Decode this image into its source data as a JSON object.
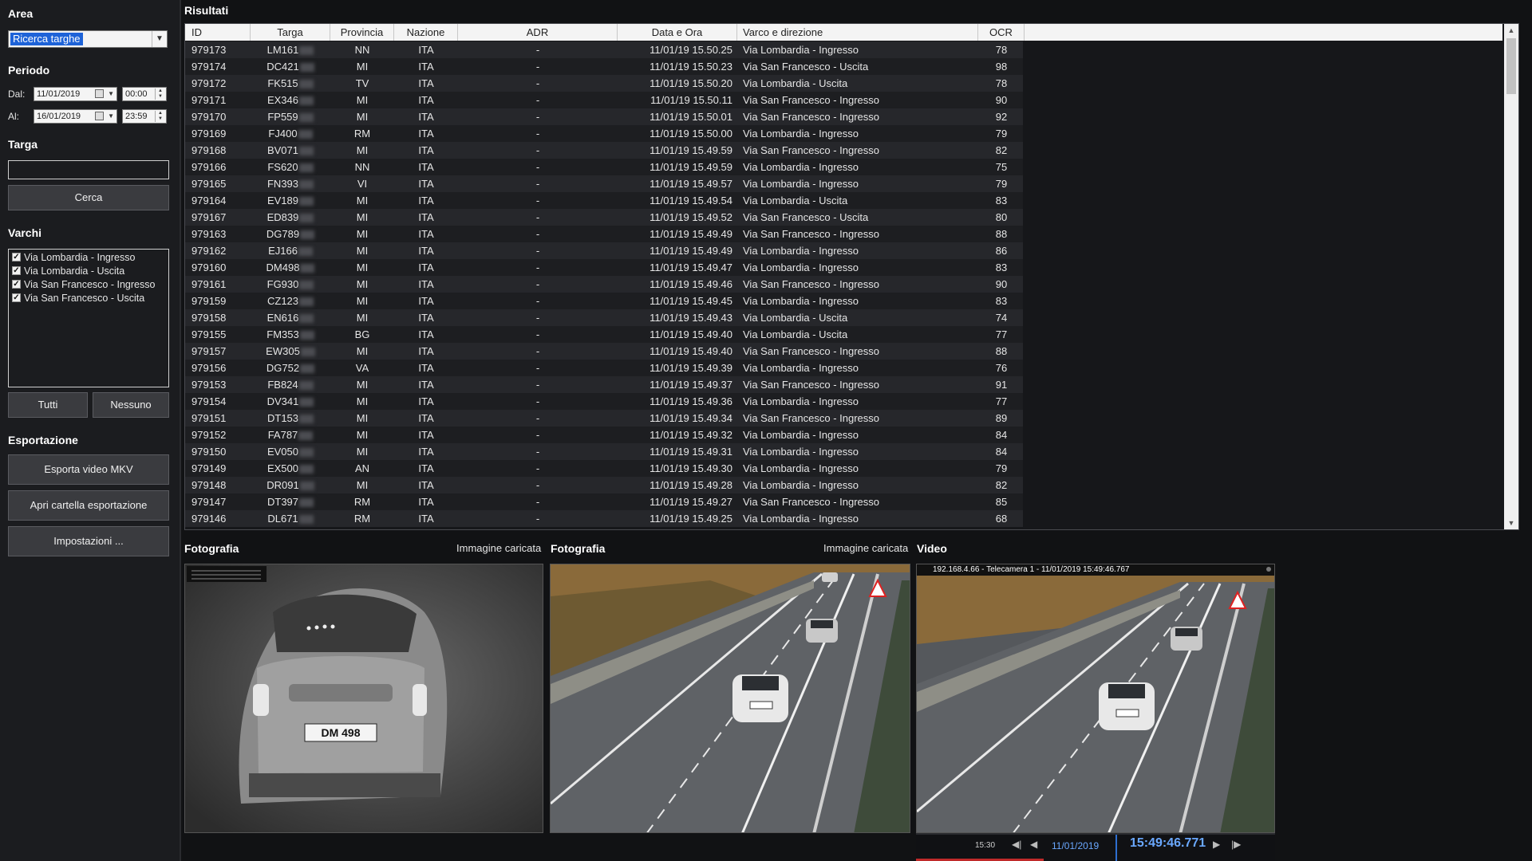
{
  "sidebar": {
    "area_title": "Area",
    "area_value": "Ricerca targhe",
    "period_title": "Periodo",
    "from_label": "Dal:",
    "from_date": "11/01/2019",
    "from_time": "00:00",
    "to_label": "Al:",
    "to_date": "16/01/2019",
    "to_time": "23:59",
    "plate_title": "Targa",
    "plate_value": "",
    "search_label": "Cerca",
    "gates_title": "Varchi",
    "gates": [
      {
        "label": "Via Lombardia - Ingresso",
        "checked": true
      },
      {
        "label": "Via Lombardia - Uscita",
        "checked": true
      },
      {
        "label": "Via San Francesco - Ingresso",
        "checked": true
      },
      {
        "label": "Via San Francesco - Uscita",
        "checked": true
      }
    ],
    "all_label": "Tutti",
    "none_label": "Nessuno",
    "export_title": "Esportazione",
    "export_mkv_label": "Esporta video MKV",
    "open_folder_label": "Apri cartella esportazione",
    "settings_label": "Impostazioni ..."
  },
  "results": {
    "title": "Risultati",
    "columns": [
      "ID",
      "Targa",
      "Provincia",
      "Nazione",
      "ADR",
      "Data e Ora",
      "Varco e direzione",
      "OCR"
    ],
    "rows": [
      [
        "979173",
        "LM161",
        "NN",
        "ITA",
        "-",
        "11/01/19 15.50.25",
        "Via Lombardia - Ingresso",
        "78"
      ],
      [
        "979174",
        "DC421",
        "MI",
        "ITA",
        "-",
        "11/01/19 15.50.23",
        "Via San Francesco - Uscita",
        "98"
      ],
      [
        "979172",
        "FK515",
        "TV",
        "ITA",
        "-",
        "11/01/19 15.50.20",
        "Via Lombardia - Uscita",
        "78"
      ],
      [
        "979171",
        "EX346",
        "MI",
        "ITA",
        "-",
        "11/01/19 15.50.11",
        "Via San Francesco - Ingresso",
        "90"
      ],
      [
        "979170",
        "FP559",
        "MI",
        "ITA",
        "-",
        "11/01/19 15.50.01",
        "Via San Francesco - Ingresso",
        "92"
      ],
      [
        "979169",
        "FJ400",
        "RM",
        "ITA",
        "-",
        "11/01/19 15.50.00",
        "Via Lombardia - Ingresso",
        "79"
      ],
      [
        "979168",
        "BV071",
        "MI",
        "ITA",
        "-",
        "11/01/19 15.49.59",
        "Via San Francesco - Ingresso",
        "82"
      ],
      [
        "979166",
        "FS620",
        "NN",
        "ITA",
        "-",
        "11/01/19 15.49.59",
        "Via Lombardia - Ingresso",
        "75"
      ],
      [
        "979165",
        "FN393",
        "VI",
        "ITA",
        "-",
        "11/01/19 15.49.57",
        "Via Lombardia - Ingresso",
        "79"
      ],
      [
        "979164",
        "EV189",
        "MI",
        "ITA",
        "-",
        "11/01/19 15.49.54",
        "Via Lombardia - Uscita",
        "83"
      ],
      [
        "979167",
        "ED839",
        "MI",
        "ITA",
        "-",
        "11/01/19 15.49.52",
        "Via San Francesco - Uscita",
        "80"
      ],
      [
        "979163",
        "DG789",
        "MI",
        "ITA",
        "-",
        "11/01/19 15.49.49",
        "Via San Francesco - Ingresso",
        "88"
      ],
      [
        "979162",
        "EJ166",
        "MI",
        "ITA",
        "-",
        "11/01/19 15.49.49",
        "Via Lombardia - Ingresso",
        "86"
      ],
      [
        "979160",
        "DM498",
        "MI",
        "ITA",
        "-",
        "11/01/19 15.49.47",
        "Via Lombardia - Ingresso",
        "83"
      ],
      [
        "979161",
        "FG930",
        "MI",
        "ITA",
        "-",
        "11/01/19 15.49.46",
        "Via San Francesco - Ingresso",
        "90"
      ],
      [
        "979159",
        "CZ123",
        "MI",
        "ITA",
        "-",
        "11/01/19 15.49.45",
        "Via Lombardia - Ingresso",
        "83"
      ],
      [
        "979158",
        "EN616",
        "MI",
        "ITA",
        "-",
        "11/01/19 15.49.43",
        "Via Lombardia - Uscita",
        "74"
      ],
      [
        "979155",
        "FM353",
        "BG",
        "ITA",
        "-",
        "11/01/19 15.49.40",
        "Via Lombardia - Uscita",
        "77"
      ],
      [
        "979157",
        "EW305",
        "MI",
        "ITA",
        "-",
        "11/01/19 15.49.40",
        "Via San Francesco - Ingresso",
        "88"
      ],
      [
        "979156",
        "DG752",
        "VA",
        "ITA",
        "-",
        "11/01/19 15.49.39",
        "Via Lombardia - Ingresso",
        "76"
      ],
      [
        "979153",
        "FB824",
        "MI",
        "ITA",
        "-",
        "11/01/19 15.49.37",
        "Via San Francesco - Ingresso",
        "91"
      ],
      [
        "979154",
        "DV341",
        "MI",
        "ITA",
        "-",
        "11/01/19 15.49.36",
        "Via Lombardia - Ingresso",
        "77"
      ],
      [
        "979151",
        "DT153",
        "MI",
        "ITA",
        "-",
        "11/01/19 15.49.34",
        "Via San Francesco - Ingresso",
        "89"
      ],
      [
        "979152",
        "FA787",
        "MI",
        "ITA",
        "-",
        "11/01/19 15.49.32",
        "Via Lombardia - Ingresso",
        "84"
      ],
      [
        "979150",
        "EV050",
        "MI",
        "ITA",
        "-",
        "11/01/19 15.49.31",
        "Via Lombardia - Ingresso",
        "84"
      ],
      [
        "979149",
        "EX500",
        "AN",
        "ITA",
        "-",
        "11/01/19 15.49.30",
        "Via Lombardia - Ingresso",
        "79"
      ],
      [
        "979148",
        "DR091",
        "MI",
        "ITA",
        "-",
        "11/01/19 15.49.28",
        "Via Lombardia - Ingresso",
        "82"
      ],
      [
        "979147",
        "DT397",
        "RM",
        "ITA",
        "-",
        "11/01/19 15.49.27",
        "Via San Francesco - Ingresso",
        "85"
      ],
      [
        "979146",
        "DL671",
        "RM",
        "ITA",
        "-",
        "11/01/19 15.49.25",
        "Via Lombardia - Ingresso",
        "68"
      ]
    ]
  },
  "photo1": {
    "title": "Fotografia",
    "status": "Immagine caricata",
    "plate_text": "DM 498"
  },
  "photo2": {
    "title": "Fotografia",
    "status": "Immagine caricata"
  },
  "video": {
    "title": "Video",
    "overlay": "192.168.4.66 - Telecamera 1 - 11/01/2019 15:49:46.767",
    "timeline_tick": "15:30",
    "date": "11/01/2019",
    "time": "15:49:46.771"
  },
  "colors": {
    "background": "#111214",
    "selection": "#1e63d8",
    "accent_time": "#6aa8ff",
    "timeline_marker": "#e03030"
  }
}
